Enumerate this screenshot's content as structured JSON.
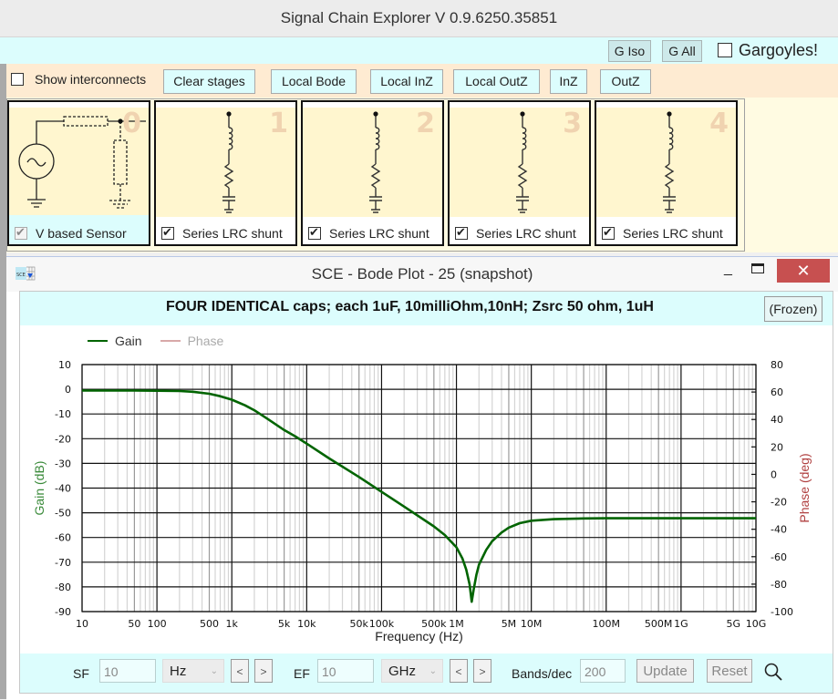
{
  "app": {
    "title": "Signal Chain Explorer V 0.9.6250.35851"
  },
  "topbar": {
    "g_iso_label": "G Iso",
    "g_all_label": "G All",
    "gargoyles_label": "Gargoyles!",
    "gargoyles_checked": false
  },
  "toolbar": {
    "show_interconnects_label": "Show interconnects",
    "show_interconnects_checked": false,
    "buttons": [
      "Clear stages",
      "Local Bode",
      "Local InZ",
      "Local OutZ",
      "InZ",
      "OutZ"
    ]
  },
  "stages": [
    {
      "index": "0",
      "label": "V based Sensor",
      "checked": true,
      "disabled": true,
      "icon": "voltage-source-schematic"
    },
    {
      "index": "1",
      "label": "Series LRC shunt",
      "checked": true,
      "disabled": false,
      "icon": "series-lrc-schematic"
    },
    {
      "index": "2",
      "label": "Series LRC shunt",
      "checked": true,
      "disabled": false,
      "icon": "series-lrc-schematic"
    },
    {
      "index": "3",
      "label": "Series LRC shunt",
      "checked": true,
      "disabled": false,
      "icon": "series-lrc-schematic"
    },
    {
      "index": "4",
      "label": "Series LRC shunt",
      "checked": true,
      "disabled": false,
      "icon": "series-lrc-schematic"
    }
  ],
  "bode_window": {
    "title": "SCE - Bode Plot - 25  (snapshot)",
    "icon_text": "SCE",
    "minimize_glyph": "_",
    "maximize_glyph": "☐",
    "close_glyph": "✕",
    "note": "FOUR IDENTICAL caps; each 1uF, 10milliOhm,10nH; Zsrc 50 ohm, 1uH",
    "frozen_label": "(Frozen)",
    "controls": {
      "sf_label": "SF",
      "sf_value": "10",
      "sf_unit": "Hz",
      "ef_label": "EF",
      "ef_value": "10",
      "ef_unit": "GHz",
      "prev_glyph": "<",
      "next_glyph": ">",
      "bands_label": "Bands/dec",
      "bands_value": "200",
      "update_label": "Update",
      "reset_label": "Reset",
      "zoom_icon": "magnifier-icon"
    }
  },
  "colors": {
    "gain": "#006400",
    "phase": "#d8a8a8",
    "phase_axis_label": "#b04040",
    "gain_axis_label": "#3a8a3a",
    "close_button": "#c75050",
    "cyan_panel": "#dcfdfd"
  },
  "chart_data": {
    "type": "line",
    "title": "",
    "xlabel": "Frequency (Hz)",
    "ylabel": "Gain (dB)",
    "y2label": "Phase (deg)",
    "xscale": "log",
    "xlim": [
      10,
      10000000000
    ],
    "ylim": [
      -90,
      10
    ],
    "y2lim": [
      -100,
      80
    ],
    "grid": true,
    "legend": {
      "placement": "top-left",
      "entries": [
        "Gain",
        "Phase"
      ]
    },
    "x_tick_labels": [
      {
        "v": 10,
        "t": "10"
      },
      {
        "v": 50,
        "t": "50"
      },
      {
        "v": 100,
        "t": "100"
      },
      {
        "v": 500,
        "t": "500"
      },
      {
        "v": 1000,
        "t": "1k"
      },
      {
        "v": 5000,
        "t": "5k"
      },
      {
        "v": 10000,
        "t": "10k"
      },
      {
        "v": 50000,
        "t": "50k"
      },
      {
        "v": 100000,
        "t": "100k"
      },
      {
        "v": 500000,
        "t": "500k"
      },
      {
        "v": 1000000,
        "t": "1M"
      },
      {
        "v": 5000000,
        "t": "5M"
      },
      {
        "v": 10000000,
        "t": "10M"
      },
      {
        "v": 100000000,
        "t": "100M"
      },
      {
        "v": 500000000,
        "t": "500M"
      },
      {
        "v": 1000000000,
        "t": "1G"
      },
      {
        "v": 5000000000,
        "t": "5G"
      },
      {
        "v": 10000000000,
        "t": "10G"
      }
    ],
    "y_ticks": [
      10,
      0,
      -10,
      -20,
      -30,
      -40,
      -50,
      -60,
      -70,
      -80,
      -90
    ],
    "y2_ticks": [
      80,
      60,
      40,
      20,
      0,
      -20,
      -40,
      -60,
      -80,
      -100
    ],
    "series": [
      {
        "name": "Gain",
        "visible": true,
        "x": [
          10,
          50,
          100,
          200,
          300,
          500,
          700,
          1000,
          1500,
          2000,
          3000,
          5000,
          7000,
          10000,
          20000,
          50000,
          100000,
          200000,
          500000,
          700000,
          1000000,
          1200000,
          1350000,
          1500000,
          1600000,
          1700000,
          1850000,
          2000000,
          2500000,
          3000000,
          4000000,
          5000000,
          7000000,
          10000000,
          20000000,
          50000000,
          100000000,
          1000000000,
          10000000000
        ],
        "y": [
          -0.5,
          -0.5,
          -0.6,
          -0.7,
          -1.0,
          -1.8,
          -2.8,
          -4.2,
          -6.5,
          -8.5,
          -12,
          -16.5,
          -19,
          -22,
          -28,
          -35.5,
          -41.5,
          -47.5,
          -55.5,
          -59,
          -64,
          -68.5,
          -73,
          -79,
          -86,
          -81,
          -75,
          -71,
          -65,
          -61.5,
          -58,
          -56,
          -54.2,
          -53.2,
          -52.6,
          -52.3,
          -52.2,
          -52.2,
          -52.2
        ]
      },
      {
        "name": "Phase",
        "visible": false,
        "x": [],
        "y": []
      }
    ]
  }
}
